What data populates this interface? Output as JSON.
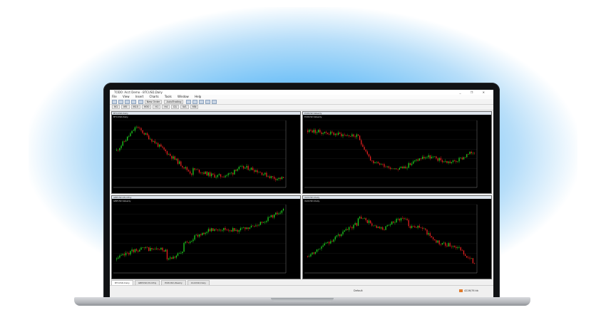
{
  "app": {
    "title": "TODO: Acct Demo - BTCUSD,Daily",
    "window_controls": "_ ❐ ✕"
  },
  "menu": [
    "File",
    "View",
    "Insert",
    "Charts",
    "Tools",
    "Window",
    "Help"
  ],
  "toolbar": {
    "new_order": "New Order",
    "autotrading": "AutoTrading",
    "timeframes": [
      "M1",
      "M5",
      "M15",
      "M30",
      "H1",
      "H4",
      "D1",
      "W1",
      "MN"
    ]
  },
  "charts": [
    {
      "title": "BTCUSD,Daily",
      "info": "BTCUSD,Daily",
      "color_up": "#1fd11f",
      "color_down": "#e52020"
    },
    {
      "title": "EURUSD,Weekly",
      "info": "EURUSD,Weekly",
      "color_up": "#1fd11f",
      "color_down": "#e52020"
    },
    {
      "title": "GBPUSD,Monthly",
      "info": "GBPUSD,Weekly",
      "color_up": "#1fd11f",
      "color_down": "#e52020"
    },
    {
      "title": "XAUUSD,Daily",
      "info": "XAUUSD,Daily",
      "color_up": "#1fd11f",
      "color_down": "#e52020"
    }
  ],
  "tabs": [
    "BTCUSD,Daily",
    "GBPUSD,Monthly",
    "EURUSD,Weekly",
    "XAUUSD,Daily"
  ],
  "status": {
    "default": "Default",
    "traffic": "4226/76 kb"
  },
  "colors": {
    "glow": "#3da8f5",
    "chart_bg": "#000000",
    "candle_up": "#1fd11f",
    "candle_down": "#e52020"
  }
}
